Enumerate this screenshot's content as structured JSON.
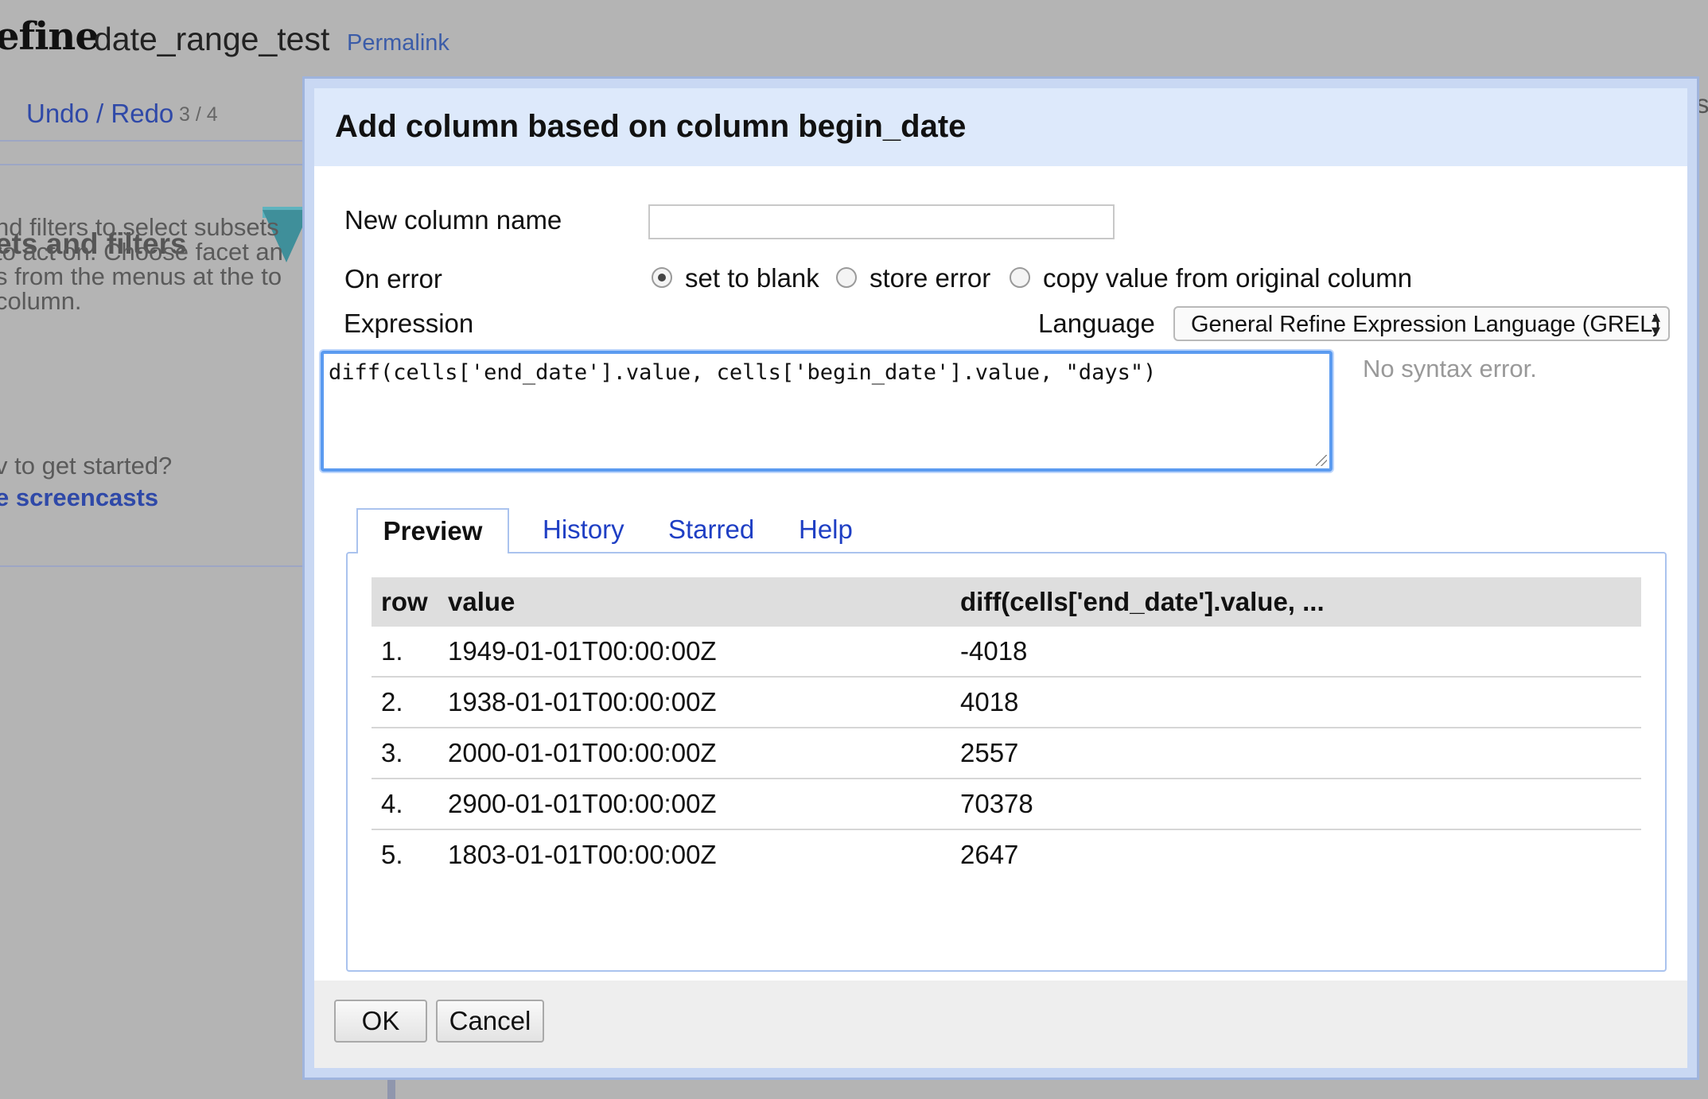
{
  "app": {
    "logo_fragment": "efine",
    "project_name": "date_range_test",
    "permalink": "Permalink",
    "undo_redo_label": "Undo / Redo",
    "undo_redo_count": "3 / 4",
    "left_panel": {
      "title_fragment": "ets and filters",
      "lines": [
        "nd filters to select subsets",
        "to act on. Choose facet an",
        "s from the menus at the to",
        " column."
      ],
      "prompt": "v to get started?",
      "link": "e screencasts"
    },
    "right_fragment": "si"
  },
  "dialog": {
    "title": "Add column based on column begin_date",
    "new_column_label": "New column name",
    "new_column_value": "",
    "on_error_label": "On error",
    "on_error_options": [
      {
        "label": "set to blank",
        "selected": true
      },
      {
        "label": "store error",
        "selected": false
      },
      {
        "label": "copy value from original column",
        "selected": false
      }
    ],
    "expression_label": "Expression",
    "language_label": "Language",
    "language_value": "General Refine Expression Language (GREL)",
    "expression": "diff(cells['end_date'].value, cells['begin_date'].value, \"days\")",
    "syntax_status": "No syntax error.",
    "tabs": [
      {
        "label": "Preview",
        "active": true
      },
      {
        "label": "History",
        "active": false
      },
      {
        "label": "Starred",
        "active": false
      },
      {
        "label": "Help",
        "active": false
      }
    ],
    "preview": {
      "headers": [
        "row",
        "value",
        "diff(cells['end_date'].value, ..."
      ],
      "rows": [
        {
          "row": "1.",
          "value": "1949-01-01T00:00:00Z",
          "result": "-4018"
        },
        {
          "row": "2.",
          "value": "1938-01-01T00:00:00Z",
          "result": "4018"
        },
        {
          "row": "3.",
          "value": "2000-01-01T00:00:00Z",
          "result": "2557"
        },
        {
          "row": "4.",
          "value": "2900-01-01T00:00:00Z",
          "result": "70378"
        },
        {
          "row": "5.",
          "value": "1803-01-01T00:00:00Z",
          "result": "2647"
        }
      ]
    },
    "ok_label": "OK",
    "cancel_label": "Cancel"
  }
}
